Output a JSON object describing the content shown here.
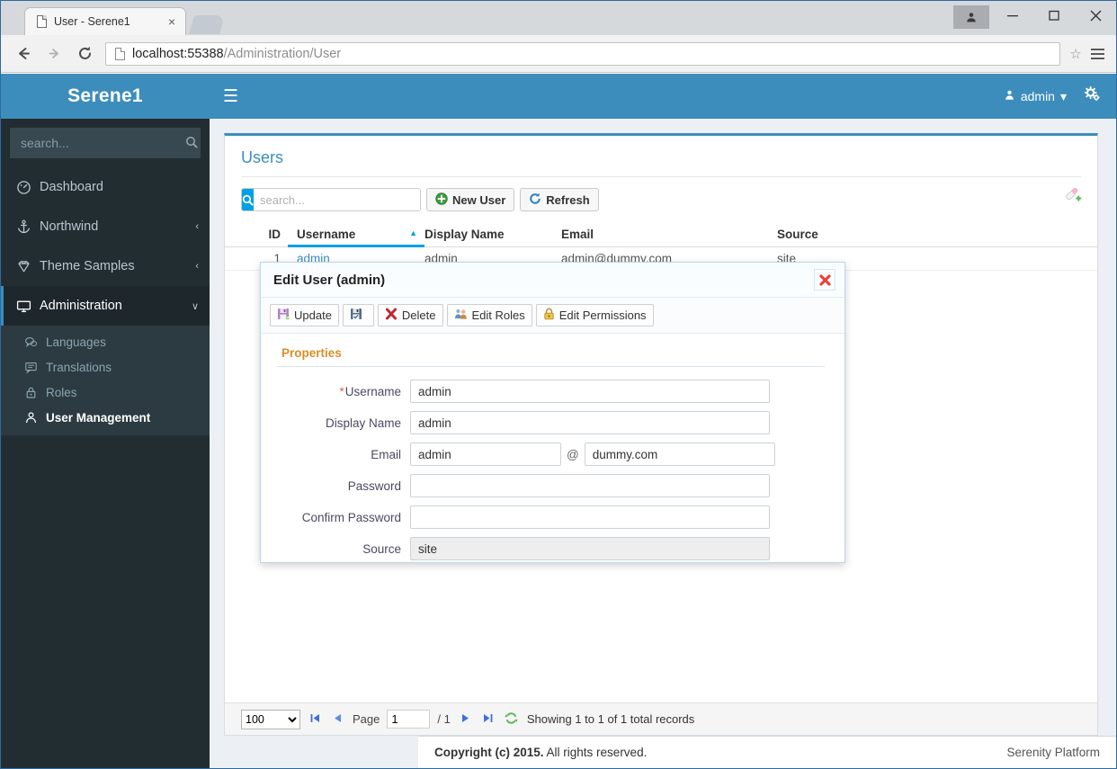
{
  "browser": {
    "tab": {
      "title": "User - Serene1",
      "close_label": "×",
      "favicon": "page-icon"
    },
    "url_host": "localhost:55388",
    "url_path": "/Administration/User",
    "back_label": "←",
    "forward_label": "→",
    "reload_label": "⟳",
    "star_label": "☆",
    "menu_label": "menu",
    "window": {
      "minimize": "—",
      "maximize": "□",
      "close": "✕",
      "user": "user-avatar"
    }
  },
  "sidebar": {
    "brand": "Serene1",
    "search_placeholder": "search...",
    "search_value": "",
    "items": [
      {
        "label": "Dashboard",
        "icon": "dashboard-icon",
        "arrow": ""
      },
      {
        "label": "Northwind",
        "icon": "anchor-icon",
        "arrow": "‹"
      },
      {
        "label": "Theme Samples",
        "icon": "diamond-icon",
        "arrow": "‹"
      },
      {
        "label": "Administration",
        "icon": "monitor-icon",
        "arrow": "∨"
      }
    ],
    "subitems": [
      {
        "label": "Languages",
        "icon": "comments-icon"
      },
      {
        "label": "Translations",
        "icon": "comment-icon"
      },
      {
        "label": "Roles",
        "icon": "lock-icon"
      },
      {
        "label": "User Management",
        "icon": "user-icon"
      }
    ]
  },
  "navbar": {
    "toggle": "☰",
    "username": "admin",
    "caret": "▾",
    "gear": "gears-icon"
  },
  "panel": {
    "title": "Users",
    "toolbar": {
      "search_placeholder": "search...",
      "search_value": "",
      "search_icon": "🔍",
      "new_user": "New User",
      "refresh": "Refresh",
      "column_picker": "column-picker-icon"
    },
    "grid": {
      "columns": [
        {
          "key": "id",
          "label": "ID",
          "sorted": false
        },
        {
          "key": "username",
          "label": "Username",
          "sorted": true,
          "caret": "▲"
        },
        {
          "key": "display_name",
          "label": "Display Name",
          "sorted": false
        },
        {
          "key": "email",
          "label": "Email",
          "sorted": false
        },
        {
          "key": "source",
          "label": "Source",
          "sorted": false
        }
      ],
      "rows": [
        {
          "id": "1",
          "username": "admin",
          "display_name": "admin",
          "email": "admin@dummy.com",
          "source": "site"
        }
      ]
    },
    "pager": {
      "page_size": "100",
      "page_size_options": [
        "100"
      ],
      "first": "◀❘",
      "prev": "◀",
      "page_label": "Page",
      "page_value": "1",
      "of_label": "/ 1",
      "next": "▶",
      "last": "❘▶",
      "refresh_icon": "refresh-icon",
      "info": "Showing 1 to 1 of 1 total records"
    }
  },
  "footer": {
    "copyright_bold": "Copyright (c) 2015.",
    "copyright_rest": " All rights reserved.",
    "right": "Serenity Platform"
  },
  "dialog": {
    "title": "Edit User (admin)",
    "close": "✖",
    "toolbar": [
      {
        "label": "Update",
        "icon": "save-icon"
      },
      {
        "label": "",
        "icon": "save-check-icon"
      },
      {
        "label": "Delete",
        "icon": "delete-x-icon"
      },
      {
        "label": "Edit Roles",
        "icon": "roles-users-icon"
      },
      {
        "label": "Edit Permissions",
        "icon": "lock-gold-icon"
      }
    ],
    "category": "Properties",
    "fields": [
      {
        "name": "username",
        "label": "Username",
        "required": true,
        "value": "admin",
        "type": "text"
      },
      {
        "name": "display_name",
        "label": "Display Name",
        "required": false,
        "value": "admin",
        "type": "text"
      },
      {
        "name": "email",
        "label": "Email",
        "required": false,
        "value": "admin",
        "type": "email",
        "at": "@",
        "domain": "dummy.com"
      },
      {
        "name": "password",
        "label": "Password",
        "required": false,
        "value": "",
        "type": "password"
      },
      {
        "name": "confirm_password",
        "label": "Confirm Password",
        "required": false,
        "value": "",
        "type": "password"
      },
      {
        "name": "source",
        "label": "Source",
        "required": false,
        "value": "site",
        "type": "readonly"
      }
    ]
  },
  "colors": {
    "brand_blue": "#3c8dbc",
    "sidebar_dark": "#222d32",
    "sidebar_sub": "#2c3b41",
    "accent_cyan": "#00a0e4",
    "category_orange": "#d98e27",
    "required_red": "#e05b5b"
  }
}
